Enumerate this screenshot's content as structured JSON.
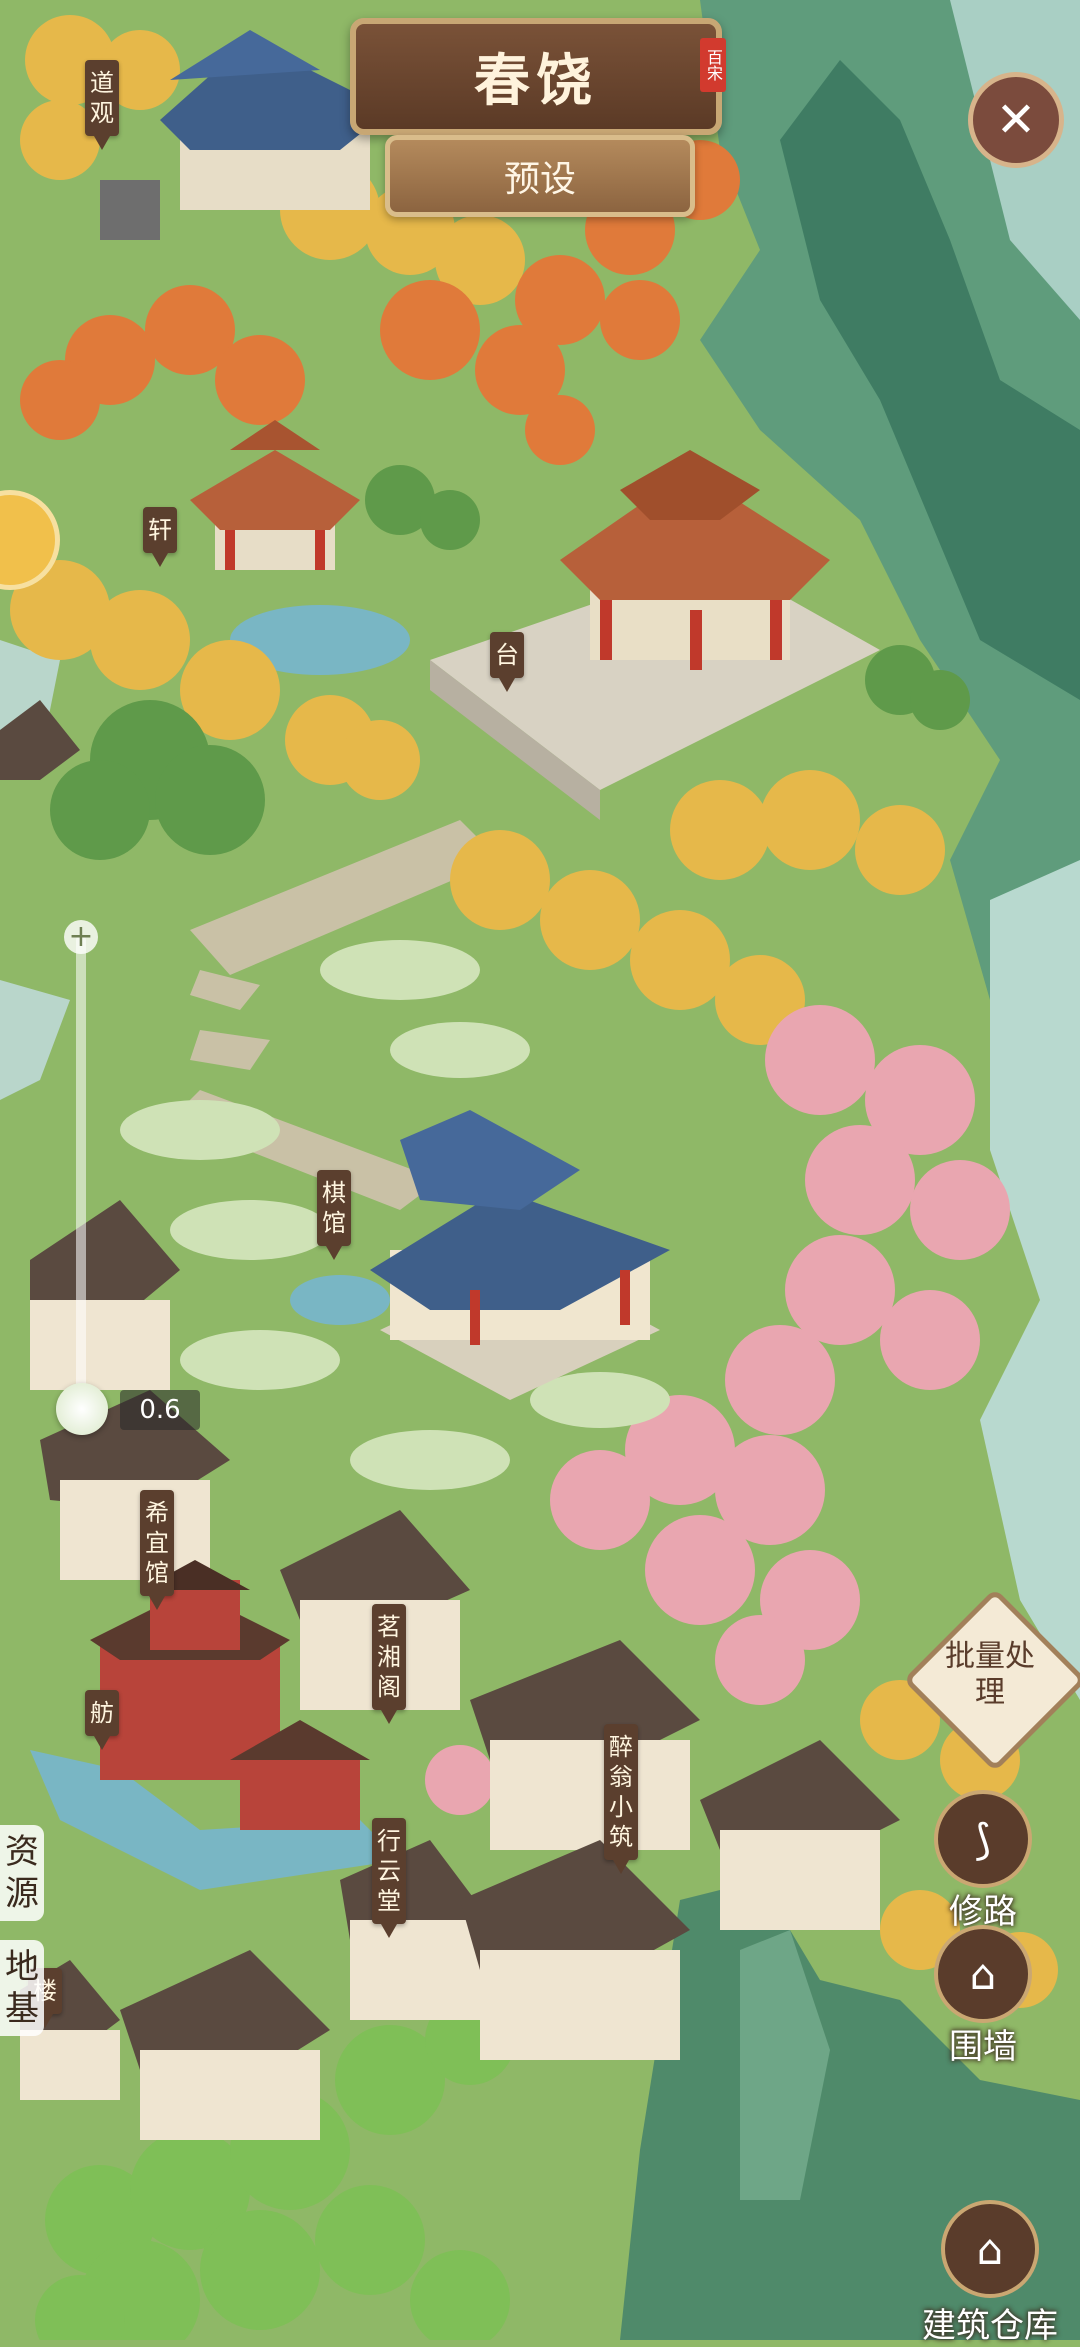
{
  "header": {
    "title": "春饶",
    "seal": "百宋",
    "preset_label": "预设",
    "close_glyph": "✕"
  },
  "buildings": [
    {
      "name": "道观"
    },
    {
      "name": "轩"
    },
    {
      "name": "台"
    },
    {
      "name": "棋馆"
    },
    {
      "name": "希宜馆"
    },
    {
      "name": "茗湘阁"
    },
    {
      "name": "舫"
    },
    {
      "name": "醉翁小筑"
    },
    {
      "name": "行云堂"
    },
    {
      "name": "楼"
    }
  ],
  "zoom": {
    "value": "0.6",
    "plus": "+"
  },
  "tools": {
    "batch": "批量处理",
    "road": "修路",
    "wall": "围墙",
    "warehouse": "建筑仓库"
  },
  "side_tabs": {
    "resources": "资源",
    "foundation": "地基"
  },
  "colors": {
    "grass": "#8fb867",
    "wood": "#5b3f2e",
    "gold": "#e6b84a",
    "maple": "#e07a3a",
    "blossom": "#e9a6b0",
    "mountain": "#4f8f72"
  }
}
